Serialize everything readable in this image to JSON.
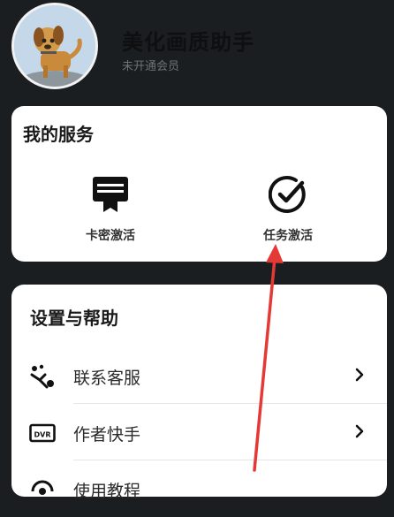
{
  "header": {
    "app_name": "美化画质助手",
    "member_status": "未开通会员"
  },
  "services": {
    "title": "我的服务",
    "items": [
      {
        "label": "卡密激活",
        "icon": "card-key-icon"
      },
      {
        "label": "任务激活",
        "icon": "check-circle-icon"
      }
    ]
  },
  "settings": {
    "title": "设置与帮助",
    "items": [
      {
        "label": "联系客服",
        "icon": "customer-service-icon"
      },
      {
        "label": "作者快手",
        "icon": "dvr-icon"
      },
      {
        "label": "使用教程",
        "icon": "tutorial-icon"
      }
    ]
  },
  "colors": {
    "background": "#1b1e21",
    "card": "#ffffff",
    "annotation_arrow": "#e53935"
  }
}
